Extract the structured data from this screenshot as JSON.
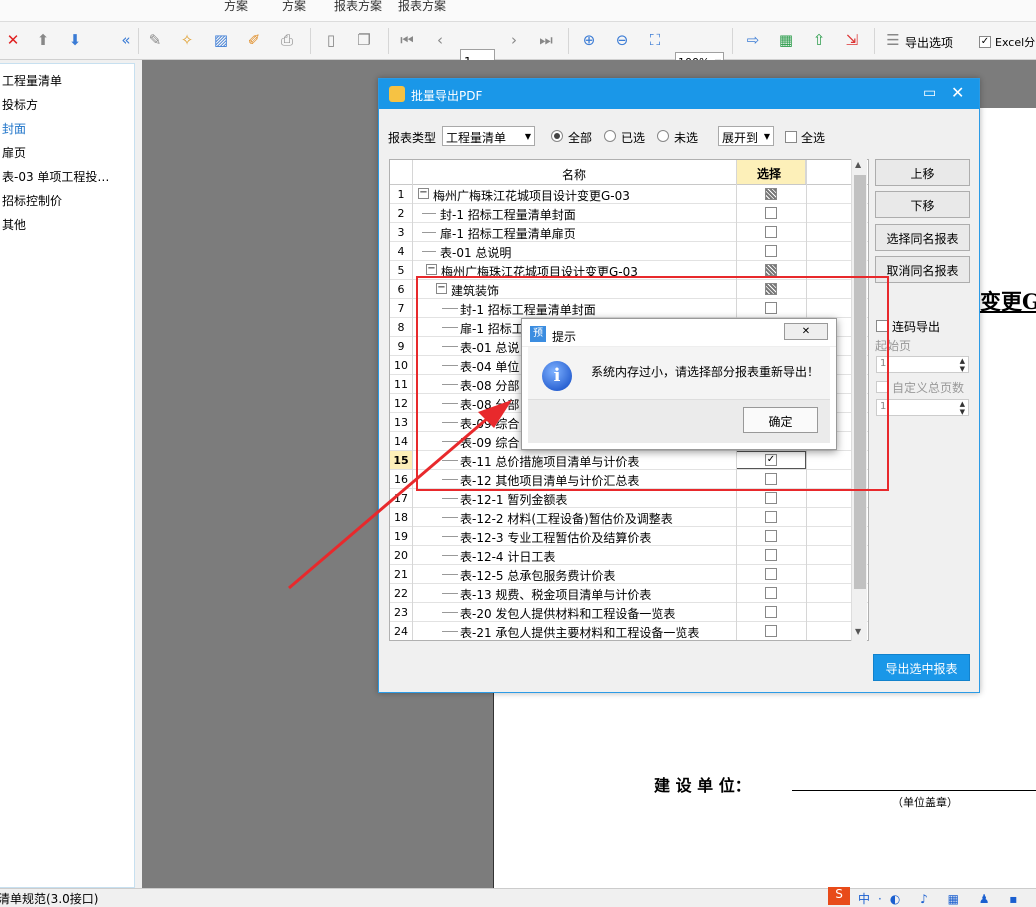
{
  "top_tabs": [
    "方案",
    "方案",
    "报表方案",
    "报表方案"
  ],
  "toolbar": {
    "page": "1",
    "zoom": "100%",
    "export_options": "导出选项",
    "excel_label": "Excel分"
  },
  "sidebar": {
    "items": [
      "工程量清单",
      "投标方",
      "封面",
      "扉页",
      "表-03 单项工程投…",
      "招标控制价",
      "其他"
    ],
    "selected_index": 2
  },
  "paper": {
    "title_fragment": "变更G-",
    "label_unit": "建 设 单 位：",
    "label_seal": "（单位盖章）"
  },
  "status_text": "清单规范(3.0接口)",
  "dialog": {
    "title": "批量导出PDF",
    "type_label": "报表类型",
    "type_value": "工程量清单",
    "radio_all": "全部",
    "radio_selected": "已选",
    "radio_unselected": "未选",
    "expand_label": "展开到",
    "select_all": "全选",
    "col_name": "名称",
    "col_select": "选择",
    "rows": [
      {
        "n": "1",
        "text": "梅州广梅珠江花城项目设计变更G-03",
        "indent": 0,
        "tree": "minus",
        "state": "part"
      },
      {
        "n": "2",
        "text": "封-1 招标工程量清单封面",
        "indent": 1,
        "state": "off"
      },
      {
        "n": "3",
        "text": "扉-1 招标工程量清单扉页",
        "indent": 1,
        "state": "off"
      },
      {
        "n": "4",
        "text": "表-01 总说明",
        "indent": 1,
        "state": "off"
      },
      {
        "n": "5",
        "text": "梅州广梅珠江花城项目设计变更G-03",
        "indent": 1,
        "tree": "minus",
        "state": "part"
      },
      {
        "n": "6",
        "text": "建筑装饰",
        "indent": 2,
        "tree": "minus",
        "state": "part"
      },
      {
        "n": "7",
        "text": "封-1 招标工程量清单封面",
        "indent": 3,
        "state": "off"
      },
      {
        "n": "8",
        "text": "扉-1 招标工",
        "indent": 3,
        "state": "off"
      },
      {
        "n": "9",
        "text": "表-01 总说",
        "indent": 3,
        "state": "off"
      },
      {
        "n": "10",
        "text": "表-04 单位",
        "indent": 3,
        "state": "off"
      },
      {
        "n": "11",
        "text": "表-08 分部",
        "indent": 3,
        "state": "off"
      },
      {
        "n": "12",
        "text": "表-08 分部",
        "indent": 3,
        "state": "off"
      },
      {
        "n": "13",
        "text": "表-09 综合",
        "indent": 3,
        "state": "off"
      },
      {
        "n": "14",
        "text": "表-09 综合",
        "indent": 3,
        "state": "off"
      },
      {
        "n": "15",
        "text": "表-11 总价措施项目清单与计价表",
        "indent": 3,
        "state": "on",
        "current": true
      },
      {
        "n": "16",
        "text": "表-12 其他项目清单与计价汇总表",
        "indent": 3,
        "state": "off"
      },
      {
        "n": "17",
        "text": "表-12-1 暂列金额表",
        "indent": 3,
        "state": "off"
      },
      {
        "n": "18",
        "text": "表-12-2 材料(工程设备)暂估价及调整表",
        "indent": 3,
        "state": "off"
      },
      {
        "n": "19",
        "text": "表-12-3 专业工程暂估价及结算价表",
        "indent": 3,
        "state": "off"
      },
      {
        "n": "20",
        "text": "表-12-4 计日工表",
        "indent": 3,
        "state": "off"
      },
      {
        "n": "21",
        "text": "表-12-5 总承包服务费计价表",
        "indent": 3,
        "state": "off"
      },
      {
        "n": "22",
        "text": "表-13 规费、税金项目清单与计价表",
        "indent": 3,
        "state": "off"
      },
      {
        "n": "23",
        "text": "表-20 发包人提供材料和工程设备一览表",
        "indent": 3,
        "state": "off"
      },
      {
        "n": "24",
        "text": "表-21 承包人提供主要材料和工程设备一览表",
        "indent": 3,
        "state": "off"
      }
    ],
    "buttons": {
      "up": "上移",
      "down": "下移",
      "select_same": "选择同名报表",
      "cancel_same": "取消同名报表",
      "export": "导出选中报表"
    },
    "continuous": "连码导出",
    "start_page": "起始页",
    "start_value": "1",
    "custom_total": "自定义总页数",
    "total_value": "1"
  },
  "message": {
    "title": "提示",
    "icon_letter": "预",
    "text": "系统内存过小，请选择部分报表重新导出！",
    "ok": "确定",
    "info_glyph": "i"
  },
  "colors": {
    "accent": "#1a97e8",
    "annotation": "#e8292c"
  }
}
